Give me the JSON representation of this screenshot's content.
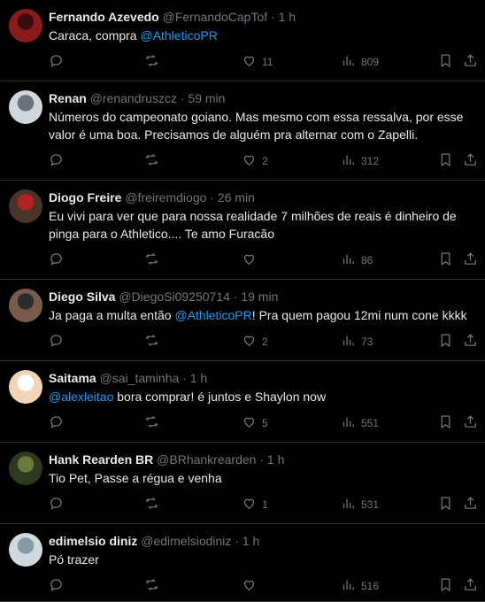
{
  "colors": {
    "background": "#000000",
    "text": "#e7e9ea",
    "muted": "#71767b",
    "link": "#1d9bf0",
    "divider": "#2f3336"
  },
  "tweets": [
    {
      "name": "Fernando Azevedo",
      "handle": "@FernandoCapTof",
      "dot": "·",
      "time": "1 h",
      "text_before": "Caraca, compra ",
      "mention": "@AthleticoPR",
      "text_after": "",
      "likes": "11",
      "views": "809"
    },
    {
      "name": "Renan",
      "handle": "@renandruszcz",
      "dot": "·",
      "time": "59 min",
      "text_before": "Números do campeonato goiano. Mas mesmo com essa ressalva, por esse valor é uma boa. Precisamos de alguém pra alternar com o Zapelli.",
      "mention": "",
      "text_after": "",
      "likes": "2",
      "views": "312"
    },
    {
      "name": "Diogo Freire",
      "handle": "@freiremdiogo",
      "dot": "·",
      "time": "26 min",
      "text_before": "Eu vivi para ver que para nossa realidade 7 milhões de reais é dinheiro de pinga para o Athletico.... Te amo Furacão",
      "mention": "",
      "text_after": "",
      "likes": "",
      "views": "86"
    },
    {
      "name": "Diego Silva",
      "handle": "@DiegoSi09250714",
      "dot": "·",
      "time": "19 min",
      "text_before": "Ja paga a multa então ",
      "mention": "@AthleticoPR",
      "text_after": "! Pra quem pagou 12mi num cone kkkk",
      "likes": "2",
      "views": "73"
    },
    {
      "name": "Saitama",
      "handle": "@sai_taminha",
      "dot": "·",
      "time": "1 h",
      "text_before": "",
      "mention": "@alexleitao",
      "text_after": " bora comprar! é juntos e Shaylon now",
      "likes": "5",
      "views": "551"
    },
    {
      "name": "Hank Rearden BR",
      "handle": "@BRhankrearden",
      "dot": "·",
      "time": "1 h",
      "text_before": "Tio Pet, Passe a régua e venha",
      "mention": "",
      "text_after": "",
      "likes": "1",
      "views": "531"
    },
    {
      "name": "edimelsio diniz",
      "handle": "@edimelsiodiniz",
      "dot": "·",
      "time": "1 h",
      "text_before": "Pó trazer",
      "mention": "",
      "text_after": "",
      "likes": "",
      "views": "516"
    }
  ]
}
